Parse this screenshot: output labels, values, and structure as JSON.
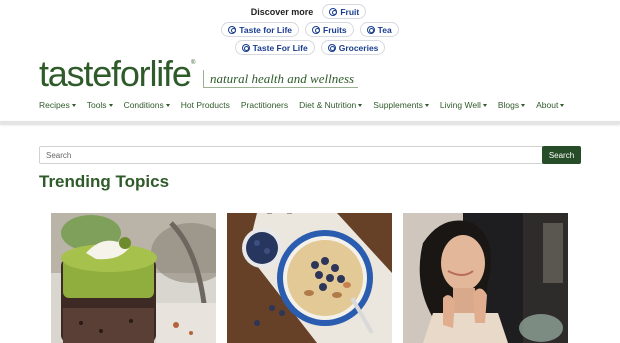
{
  "discover": {
    "lead": "Discover more",
    "row1": [
      "Fruit"
    ],
    "row2": [
      "Taste for Life",
      "Fruits",
      "Tea"
    ],
    "row3": [
      "Taste For Life",
      "Groceries"
    ]
  },
  "brand": {
    "logo": "tasteforlife",
    "tagline": "natural health and wellness",
    "color": "#2f5b2a"
  },
  "nav": {
    "items": [
      {
        "label": "Recipes",
        "dropdown": true
      },
      {
        "label": "Tools",
        "dropdown": true
      },
      {
        "label": "Conditions",
        "dropdown": true
      },
      {
        "label": "Hot Products",
        "dropdown": false
      },
      {
        "label": "Practitioners",
        "dropdown": false
      },
      {
        "label": "Diet & Nutrition",
        "dropdown": true
      },
      {
        "label": "Supplements",
        "dropdown": true
      },
      {
        "label": "Living Well",
        "dropdown": true
      },
      {
        "label": "Blogs",
        "dropdown": true
      },
      {
        "label": "About",
        "dropdown": true
      }
    ]
  },
  "search": {
    "placeholder": "Search",
    "button": "Search"
  },
  "trending": {
    "title": "Trending Topics"
  }
}
